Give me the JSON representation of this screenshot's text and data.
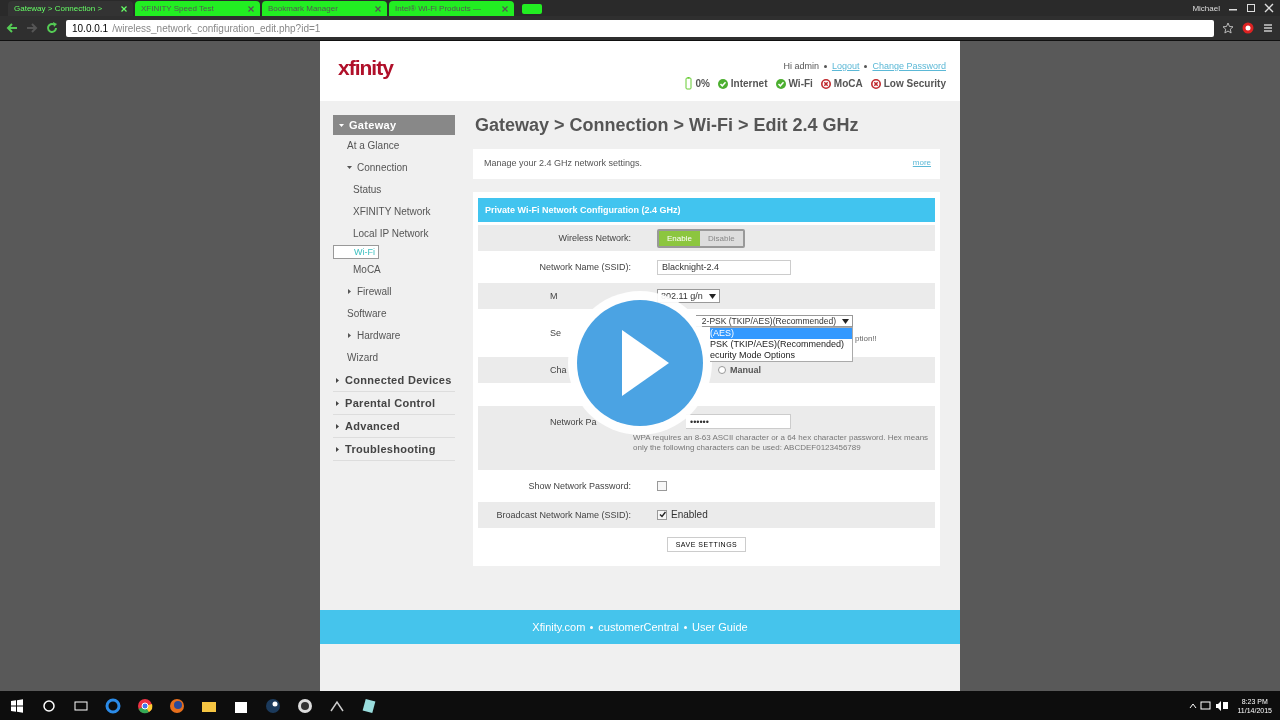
{
  "browser": {
    "tabs": [
      {
        "title": "Gateway > Connection >",
        "selected": true
      },
      {
        "title": "XFINITY Speed Test",
        "selected": false
      },
      {
        "title": "Bookmark Manager",
        "selected": false
      },
      {
        "title": "Intel® Wi-Fi Products —",
        "selected": false
      }
    ],
    "url_host": "10.0.0.1",
    "url_path": "/wireless_network_configuration_edit.php?id=1",
    "user": "Michael"
  },
  "header": {
    "logo": "xfinity",
    "greeting": "Hi admin",
    "links": [
      "Logout",
      "Change Password"
    ],
    "status": [
      {
        "label": "0%",
        "kind": "battery"
      },
      {
        "label": "Internet",
        "kind": "ok"
      },
      {
        "label": "Wi-Fi",
        "kind": "ok"
      },
      {
        "label": "MoCA",
        "kind": "error"
      },
      {
        "label": "Low Security",
        "kind": "error"
      }
    ]
  },
  "sidebar": {
    "items": [
      {
        "label": "Gateway",
        "expanded": true,
        "children": [
          {
            "label": "At a Glance",
            "selected": false
          },
          {
            "label": "Connection",
            "expanded": true,
            "children": [
              {
                "label": "Status",
                "selected": false
              },
              {
                "label": "XFINITY Network",
                "selected": false
              },
              {
                "label": "Local IP Network",
                "selected": false
              },
              {
                "label": "Wi-Fi",
                "selected": true
              },
              {
                "label": "MoCA",
                "selected": false
              }
            ]
          },
          {
            "label": "Firewall",
            "expanded": false
          },
          {
            "label": "Software",
            "selected": false
          },
          {
            "label": "Hardware",
            "expanded": false
          },
          {
            "label": "Wizard",
            "selected": false
          }
        ]
      },
      {
        "label": "Connected Devices",
        "expanded": false
      },
      {
        "label": "Parental Control",
        "expanded": false
      },
      {
        "label": "Advanced",
        "expanded": false
      },
      {
        "label": "Troubleshooting",
        "expanded": false
      }
    ]
  },
  "page": {
    "title": "Gateway > Connection > Wi-Fi > Edit 2.4 GHz",
    "intro": "Manage your 2.4 GHz network settings.",
    "more": "more"
  },
  "form": {
    "title": "Private Wi-Fi Network Configuration (2.4 GHz)",
    "rows": [
      {
        "kind": "toggle",
        "label": "Wireless Network:",
        "shaded": true,
        "options": [
          {
            "label": "Enable",
            "selected": true
          },
          {
            "label": "Disable",
            "selected": false
          }
        ]
      },
      {
        "kind": "text",
        "label": "Network Name (SSID):",
        "shaded": false,
        "value": "Blacknight-2.4"
      },
      {
        "kind": "select",
        "label": "M",
        "label_clipped": true,
        "shaded": true,
        "value": "802.11 g/n"
      },
      {
        "kind": "dropdown",
        "label": "Se",
        "label_clipped": true,
        "shaded": false,
        "value": "2-PSK (TKIP/AES)(Recommended)",
        "note": "ption!!",
        "options": [
          {
            "label": "(AES)",
            "selected": true
          },
          {
            "label": "PSK (TKIP/AES)(Recommended)",
            "selected": false
          },
          {
            "label": "ecurity Mode Options",
            "selected": false
          }
        ]
      },
      {
        "kind": "radio",
        "label": "Cha",
        "label_clipped": true,
        "shaded": true,
        "options": [
          {
            "label": "Manual",
            "selected": false
          }
        ]
      },
      {
        "kind": "password",
        "label": "Network Pa",
        "label_clipped": true,
        "shaded": true,
        "value": "••••••",
        "note": "WPA requires an 8-63 ASCII character or a 64 hex character password. Hex means only the following characters can be used: ABCDEF0123456789"
      },
      {
        "kind": "checkbox",
        "label": "Show Network Password:",
        "shaded": false,
        "checked": false
      },
      {
        "kind": "checkbox",
        "label": "Broadcast Network Name (SSID):",
        "shaded": true,
        "checked": true,
        "text": "Enabled"
      }
    ],
    "save": "SAVE SETTINGS"
  },
  "footer": {
    "links": [
      "Xfinity.com",
      "customerCentral",
      "User Guide"
    ]
  },
  "taskbar": {
    "time": "8:23 PM",
    "date": "11/14/2015"
  }
}
